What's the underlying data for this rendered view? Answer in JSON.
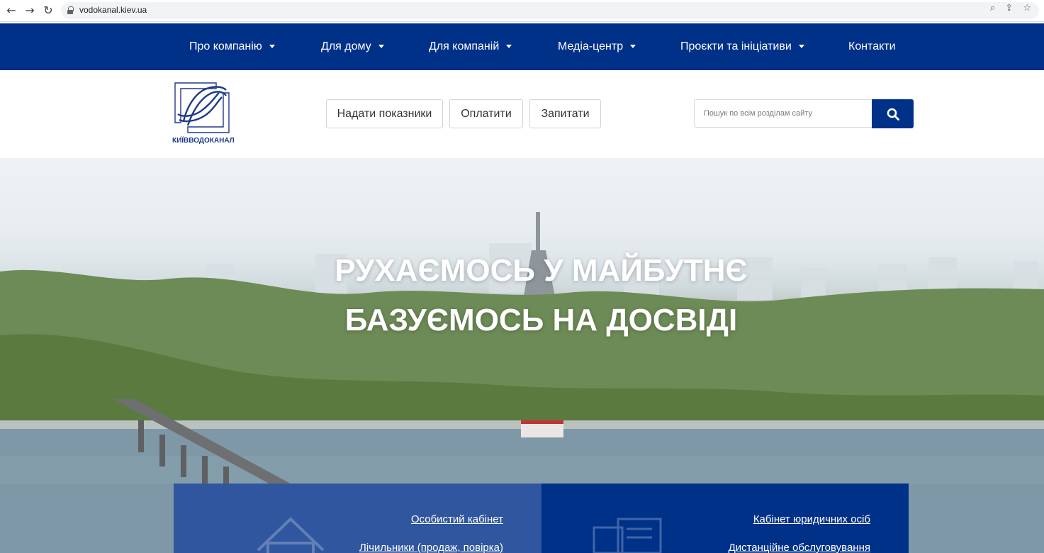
{
  "browser": {
    "url": "vodokanal.kiev.ua"
  },
  "nav": {
    "items": [
      {
        "label": "Про компанію",
        "dropdown": true
      },
      {
        "label": "Для дому",
        "dropdown": true
      },
      {
        "label": "Для компаній",
        "dropdown": true
      },
      {
        "label": "Медіа-центр",
        "dropdown": true
      },
      {
        "label": "Проєкти та ініціативи",
        "dropdown": true
      },
      {
        "label": "Контакти",
        "dropdown": false
      }
    ]
  },
  "header": {
    "logo_text": "КИЇВВОДОКАНАЛ",
    "buttons": {
      "submit_readings": "Надати показники",
      "pay": "Оплатити",
      "ask": "Запитати"
    },
    "search": {
      "placeholder": "Пошук по всім розділам сайту",
      "icon": "search-icon"
    }
  },
  "hero": {
    "line1": "РУХАЄМОСЬ У МАЙБУТНЄ",
    "line2": "БАЗУЄМОСЬ НА ДОСВІДІ"
  },
  "cards": {
    "personal": {
      "link1": "Особистий кабінет",
      "link2": "Лічильники (продаж, повірка)",
      "icon": "house-icon"
    },
    "business": {
      "link1": "Кабінет юридичних осіб",
      "link2": "Дистанційне обслуговування",
      "icon": "building-icon"
    }
  },
  "colors": {
    "brand_blue": "#003189",
    "card_light_blue": "#2f569e"
  }
}
